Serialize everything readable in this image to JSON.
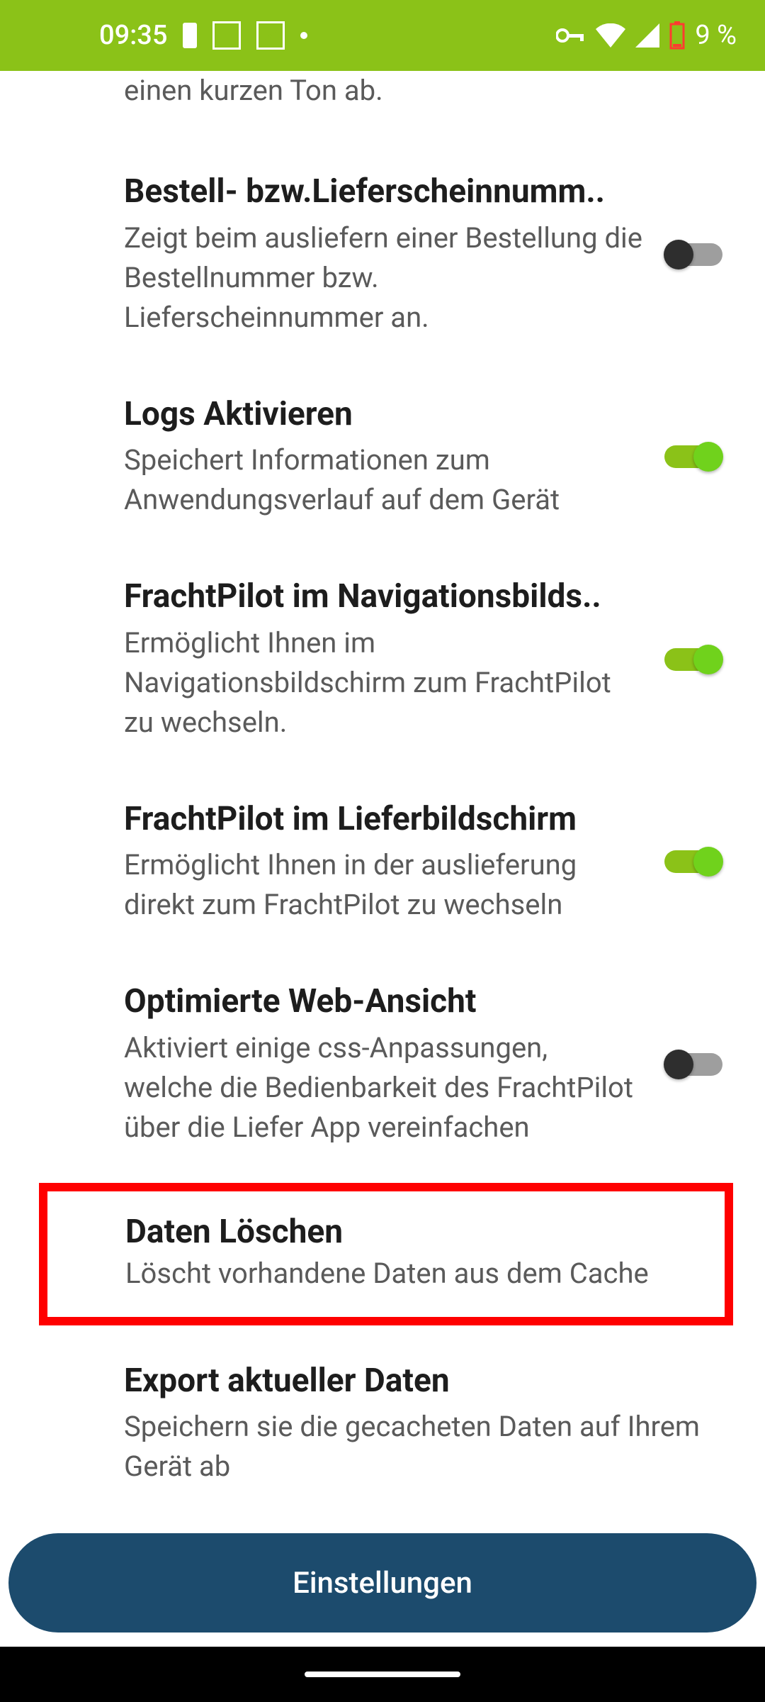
{
  "status_bar": {
    "time": "09:35",
    "battery_percent": "9 %"
  },
  "partial_row_text": "einen kurzen Ton ab.",
  "settings": [
    {
      "title": "Bestell- bzw.Lieferscheinnumm",
      "desc": "Zeigt beim ausliefern einer Bestellung die Bestellnummer bzw. Lieferscheinnummer an.",
      "on": false,
      "ellipsis": true
    },
    {
      "title": "Logs Aktivieren",
      "desc": "Speichert Informationen zum Anwendungsverlauf auf dem Gerät",
      "on": true,
      "ellipsis": false
    },
    {
      "title": "FrachtPilot im Navigationsbilds",
      "desc": "Ermöglicht Ihnen im Navigationsbildschirm zum FrachtPilot zu wechseln.",
      "on": true,
      "ellipsis": true
    },
    {
      "title": "FrachtPilot im Lieferbildschirm",
      "desc": "Ermöglicht Ihnen in der auslieferung direkt zum FrachtPilot zu wechseln",
      "on": true,
      "ellipsis": false
    },
    {
      "title": "Optimierte Web-Ansicht",
      "desc": "Aktiviert einige css-Anpassungen, welche die Bedienbarkeit des FrachtPilot über die Liefer App vereinfachen",
      "on": false,
      "ellipsis": false
    }
  ],
  "clear_data": {
    "title": "Daten Löschen",
    "desc": "Löscht vorhandene Daten aus dem Cache"
  },
  "export_data": {
    "title": "Export aktueller Daten",
    "desc": "Speichern sie die gecacheten Daten auf Ihrem Gerät ab"
  },
  "bottom_button": "Einstellungen"
}
